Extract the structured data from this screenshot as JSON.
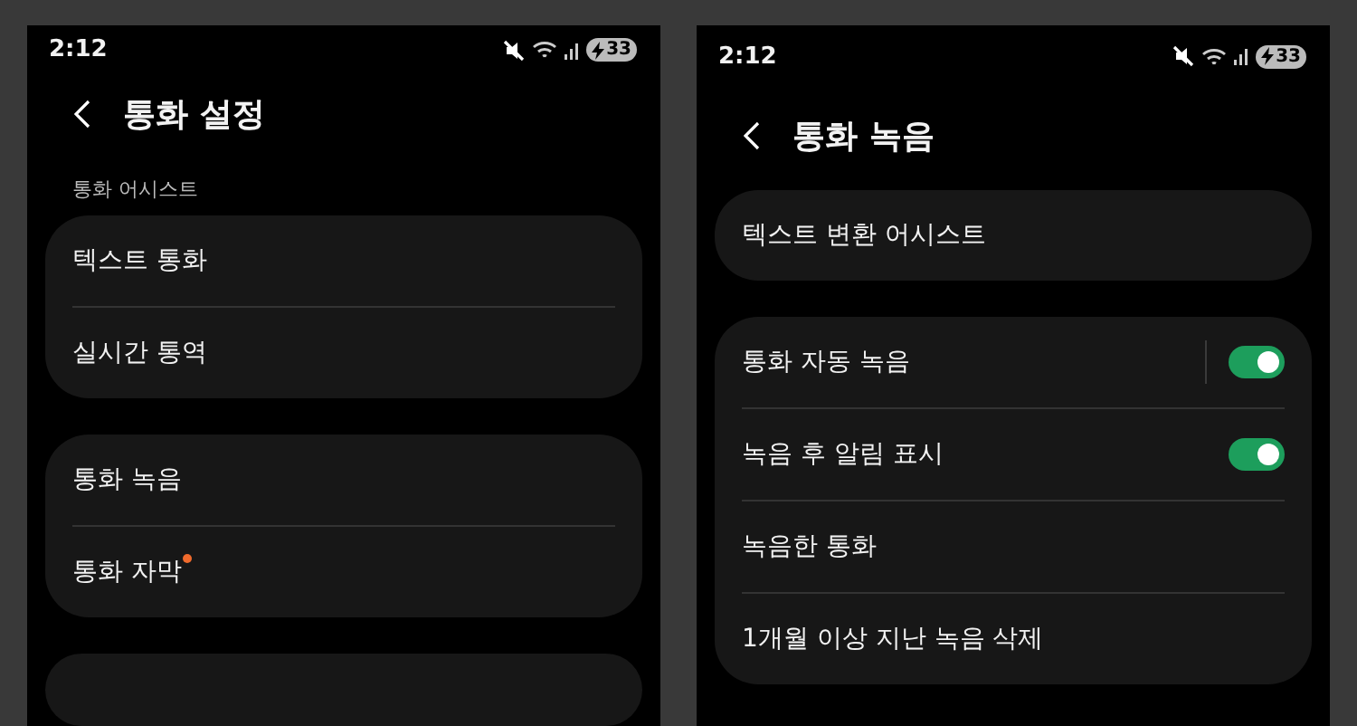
{
  "phones": [
    {
      "status_bar": {
        "time": "2:12",
        "battery": "33"
      },
      "title": "통화 설정",
      "more_below": true,
      "sections": [
        {
          "label": "통화 어시스트",
          "items": [
            {
              "kind": "link",
              "text": "텍스트 통화"
            },
            {
              "kind": "link",
              "text": "실시간 통역"
            }
          ]
        },
        {
          "items": [
            {
              "kind": "link",
              "text": "통화 녹음"
            },
            {
              "kind": "link",
              "text": "통화 자막",
              "new_badge": true
            }
          ]
        }
      ]
    },
    {
      "status_bar": {
        "time": "2:12",
        "battery": "33"
      },
      "title": "통화 녹음",
      "more_below": false,
      "sections": [
        {
          "items": [
            {
              "kind": "link",
              "text": "텍스트 변환 어시스트"
            }
          ]
        },
        {
          "items": [
            {
              "kind": "toggle",
              "text": "통화 자동 녹음",
              "on": true,
              "split": true
            },
            {
              "kind": "toggle",
              "text": "녹음 후 알림 표시",
              "on": true
            },
            {
              "kind": "link",
              "text": "녹음한 통화"
            },
            {
              "kind": "link",
              "text": "1개월 이상 지난 녹음 삭제"
            }
          ]
        }
      ]
    }
  ]
}
